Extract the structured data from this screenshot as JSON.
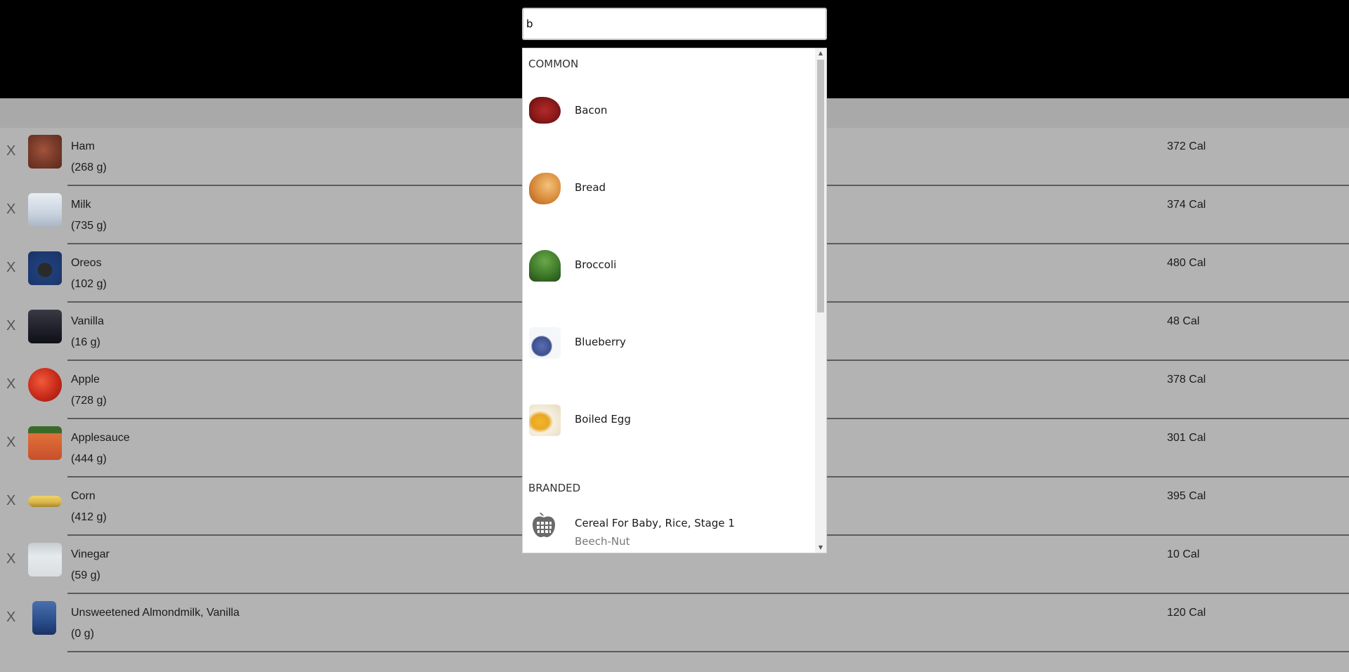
{
  "search": {
    "value": "b",
    "placeholder": ""
  },
  "dropdown": {
    "common_header": "COMMON",
    "common": [
      {
        "label": "Bacon",
        "icon": "bacon-image",
        "color": "#8b1a1a"
      },
      {
        "label": "Bread",
        "icon": "bread-image",
        "color": "#d98a3a"
      },
      {
        "label": "Broccoli",
        "icon": "broccoli-image",
        "color": "#3f7a2a"
      },
      {
        "label": "Blueberry",
        "icon": "blueberry-image",
        "color": "#3d4f8f"
      },
      {
        "label": "Boiled Egg",
        "icon": "boiled-egg-image",
        "color": "#e8a824"
      }
    ],
    "branded_header": "BRANDED",
    "branded": [
      {
        "label": "Cereal For Baby, Rice, Stage 1",
        "sub": "Beech-Nut",
        "icon": "apple-grid-icon"
      }
    ]
  },
  "foods": [
    {
      "name": "Ham",
      "qty": "(268 g)",
      "cal": "372 Cal",
      "icon": "ham-image",
      "color": "#7a3b2a"
    },
    {
      "name": "Milk",
      "qty": "(735 g)",
      "cal": "374 Cal",
      "icon": "milk-image",
      "color": "#c9d3e0"
    },
    {
      "name": "Oreos",
      "qty": "(102 g)",
      "cal": "480 Cal",
      "icon": "oreos-image",
      "color": "#1f3f7a"
    },
    {
      "name": "Vanilla",
      "qty": "(16 g)",
      "cal": "48 Cal",
      "icon": "vanilla-image",
      "color": "#1f1f2a"
    },
    {
      "name": "Apple",
      "qty": "(728 g)",
      "cal": "378 Cal",
      "icon": "apple-image",
      "color": "#c82a1a"
    },
    {
      "name": "Applesauce",
      "qty": "(444 g)",
      "cal": "301 Cal",
      "icon": "applesauce-image",
      "color": "#c8502a"
    },
    {
      "name": "Corn",
      "qty": "(412 g)",
      "cal": "395 Cal",
      "icon": "corn-image",
      "color": "#d7b44a"
    },
    {
      "name": "Vinegar",
      "qty": "(59 g)",
      "cal": "10 Cal",
      "icon": "vinegar-image",
      "color": "#d9dde0"
    },
    {
      "name": "Unsweetened Almondmilk, Vanilla",
      "qty": "(0 g)",
      "cal": "120 Cal",
      "icon": "almondmilk-image",
      "color": "#2a4e8a"
    }
  ],
  "remove_label": "X"
}
